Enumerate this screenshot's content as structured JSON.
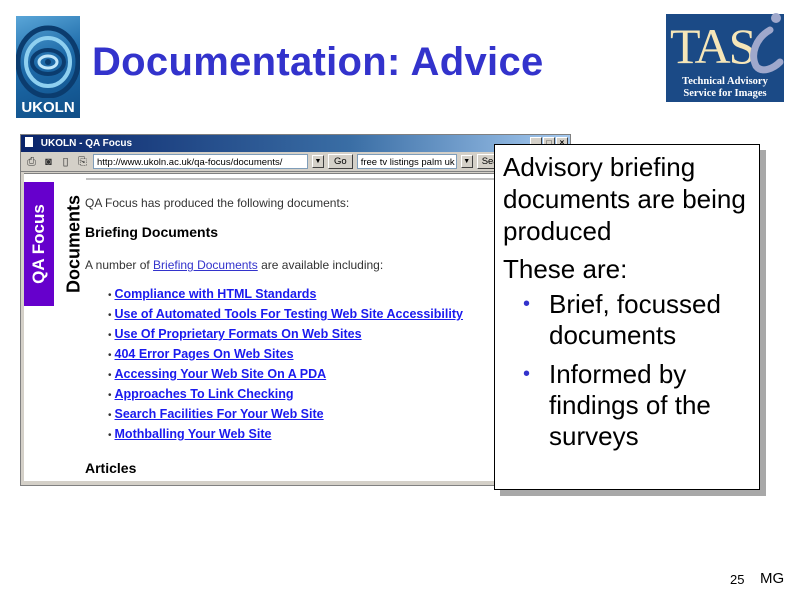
{
  "slide": {
    "title": "Documentation: Advice",
    "page_number": "25",
    "author_initials": "MG"
  },
  "logos": {
    "ukoln": {
      "text": "UKOLN"
    },
    "tasi": {
      "big": "TAS",
      "line1": "Technical Advisory",
      "line2": "Service for Images"
    }
  },
  "browser": {
    "window_title": "UKOLN - QA Focus",
    "address": "http://www.ukoln.ac.uk/qa-focus/documents/",
    "go_label": "Go",
    "search_value": "free tv listings palm uk",
    "search_label": "Sear",
    "page": {
      "sidebar_label": "QA Focus",
      "section_label": "Documents",
      "intro": "QA Focus has produced the following documents:",
      "heading_briefing": "Briefing Documents",
      "avail_prefix": "A number of ",
      "avail_link": "Briefing Documents",
      "avail_suffix": " are available including:",
      "documents": [
        "Compliance with HTML Standards",
        "Use of Automated Tools For Testing Web Site Accessibility",
        "Use Of Proprietary Formats On Web Sites",
        "404 Error Pages On Web Sites",
        "Accessing Your Web Site On A PDA",
        "Approaches To Link Checking",
        "Search Facilities For Your Web Site",
        "Mothballing Your Web Site"
      ],
      "heading_articles": "Articles"
    }
  },
  "callout": {
    "para1": "Advisory briefing documents are being produced",
    "para2": "These are:",
    "bullets": [
      "Brief, focussed documents",
      "Informed by findings of the surveys"
    ],
    "bullet_color": "#3333cc"
  },
  "colors": {
    "title": "#3333cc",
    "sidebar": "#6600cc",
    "link": "#1a1aee",
    "tasi_bg": "#1b4a86"
  }
}
